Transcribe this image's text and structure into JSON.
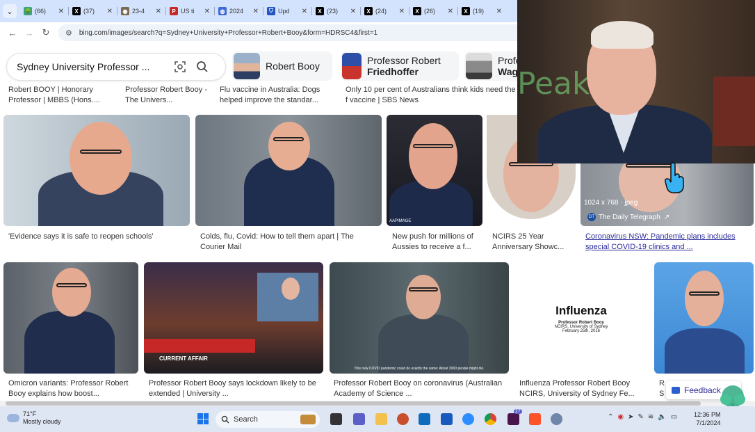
{
  "tabs": [
    {
      "label": "(66)",
      "icon": "tree-icon",
      "color": "#3aa57a"
    },
    {
      "label": "(37)",
      "icon": "x-logo-icon",
      "color": "#000000"
    },
    {
      "label": "23-4",
      "icon": "seal-icon",
      "color": "#7a6a4f"
    },
    {
      "label": "US ti",
      "icon": "p-logo-icon",
      "color": "#c62828"
    },
    {
      "label": "2024",
      "icon": "globe-icon",
      "color": "#3f6ad8"
    },
    {
      "label": "Upd",
      "icon": "shield-icon",
      "color": "#2455c3"
    },
    {
      "label": "(23)",
      "icon": "x-logo-icon",
      "color": "#000000"
    },
    {
      "label": "(24)",
      "icon": "x-logo-icon",
      "color": "#000000"
    },
    {
      "label": "(26)",
      "icon": "x-logo-icon",
      "color": "#000000"
    },
    {
      "label": "(19)",
      "icon": "x-logo-icon",
      "color": "#000000"
    }
  ],
  "address": {
    "url": "bing.com/images/search?q=Sydney+University+Professor+Robert+Booy&form=HDRSC4&first=1"
  },
  "search": {
    "query": "Sydney University Professor ..."
  },
  "chips": [
    {
      "label": "Robert Booy",
      "label_bold": ""
    },
    {
      "label": "Professor Robert",
      "label_bold": "Friedhoffer"
    },
    {
      "label": "Profe",
      "label_bold": "Wag"
    }
  ],
  "captions_top": [
    "Robert BOOY | Honorary Professor | MBBS (Hons....",
    "Professor Robert Booy - The Univers...",
    "Flu vaccine in Australia: Dogs helped improve the standar...",
    "Only 10 per cent of Australians think kids need the f vaccine | SBS News"
  ],
  "row1": [
    {
      "caption": "'Evidence says it is safe to reopen schools'"
    },
    {
      "caption": "Colds, flu, Covid: How to tell them apart | The Courier Mail"
    },
    {
      "caption": "New push for millions of Aussies to receive a f...",
      "overlay": "AAPIMAGE"
    },
    {
      "caption": "NCIRS 25 Year Anniversary Showc..."
    },
    {
      "caption": "Coronavirus NSW: Pandemic plans includes special COVID-19 clinics and ...",
      "meta": "1024 x 768 · jpeg",
      "source": "The Daily Telegraph",
      "source_badge": "DT"
    }
  ],
  "row2": [
    {
      "caption": "Omicron variants: Professor Robert Booy explains how boost..."
    },
    {
      "caption": "Professor Robert Booy says lockdown likely to be extended | University ...",
      "overlay": "CURRENT AFFAIR"
    },
    {
      "caption": "Professor Robert Booy on coronavirus (Australian Academy of Science ...",
      "subtitle": "This new COVID pandemic could do exactly the same: About 3000 people might die."
    },
    {
      "caption": "Influenza Professor Robert Booy NCIRS, University of Sydney Fe...",
      "slide_title": "Influenza",
      "slide_line1": "Professor Robert Booy",
      "slide_line2": "NCIRS, University of Sydney",
      "slide_line3": "February 25th, 2016"
    },
    {
      "caption": "R S"
    }
  ],
  "feedback": {
    "label": "Feedback"
  },
  "webcam": {
    "neon_text": "Peak"
  },
  "taskbar": {
    "temp": "71°F",
    "weather": "Mostly cloudy",
    "search_label": "Search",
    "time": "12:36 PM",
    "date": "7/1/2024",
    "badge_count": "27"
  }
}
